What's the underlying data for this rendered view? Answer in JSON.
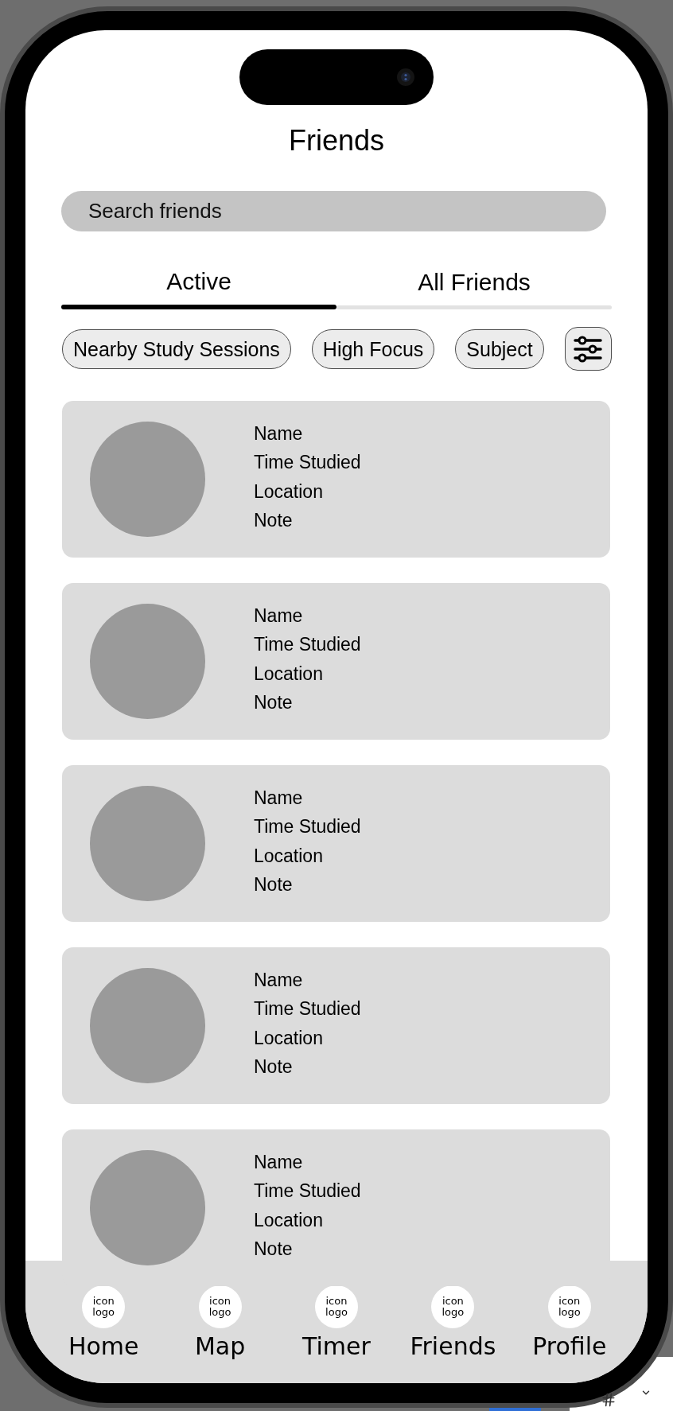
{
  "screen": {
    "title": "Friends"
  },
  "search": {
    "placeholder": "Search friends"
  },
  "tabs": [
    {
      "label": "Active",
      "selected": true
    },
    {
      "label": "All Friends",
      "selected": false
    }
  ],
  "filters": [
    {
      "label": "Nearby Study Sessions"
    },
    {
      "label": "High Focus"
    },
    {
      "label": "Subject"
    }
  ],
  "friends": [
    {
      "name": "Name",
      "time_studied": "Time Studied",
      "location": "Location",
      "note": "Note"
    },
    {
      "name": "Name",
      "time_studied": "Time Studied",
      "location": "Location",
      "note": "Note"
    },
    {
      "name": "Name",
      "time_studied": "Time Studied",
      "location": "Location",
      "note": "Note"
    },
    {
      "name": "Name",
      "time_studied": "Time Studied",
      "location": "Location",
      "note": "Note"
    },
    {
      "name": "Name",
      "time_studied": "Time Studied",
      "location": "Location",
      "note": "Note"
    }
  ],
  "bottom_nav": [
    {
      "icon_text": "icon logo",
      "label": "Home"
    },
    {
      "icon_text": "icon logo",
      "label": "Map"
    },
    {
      "icon_text": "icon logo",
      "label": "Timer"
    },
    {
      "icon_text": "icon logo",
      "label": "Friends"
    },
    {
      "icon_text": "icon logo",
      "label": "Profile"
    }
  ]
}
